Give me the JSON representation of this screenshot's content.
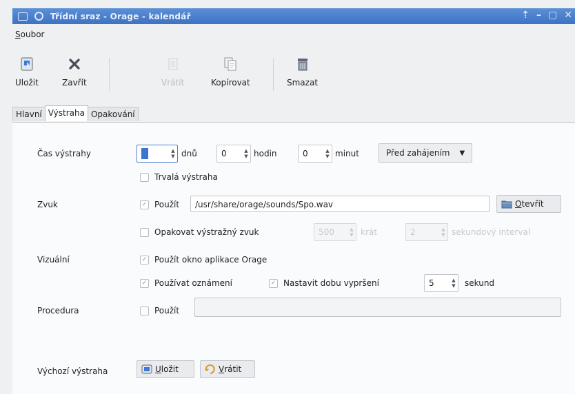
{
  "window": {
    "title": "Třídní sraz - Orage - kalendář"
  },
  "menu": {
    "file": "Soubor"
  },
  "toolbar": {
    "save": "Uložit",
    "close": "Zavřít",
    "revert": "Vrátit",
    "copy": "Kopírovat",
    "delete": "Smazat"
  },
  "tabs": [
    "Hlavní",
    "Výstraha",
    "Opakování"
  ],
  "alarm": {
    "time_label": "Čas výstrahy",
    "days_value": "",
    "days_unit": "dnů",
    "hours_value": "0",
    "hours_unit": "hodin",
    "minutes_value": "0",
    "minutes_unit": "minut",
    "relation": "Před zahájením",
    "persistent": "Trvalá výstraha"
  },
  "sound": {
    "label": "Zvuk",
    "use": "Použít",
    "file": "/usr/share/orage/sounds/Spo.wav",
    "open_button": "Otevřít",
    "repeat": "Opakovat výstražný zvuk",
    "repeat_count": "500",
    "repeat_unit": "krát",
    "interval_value": "2",
    "interval_unit": "sekundový interval"
  },
  "visual": {
    "label": "Vizuální",
    "use_window": "Použít okno aplikace Orage",
    "use_notify": "Používat oznámení",
    "set_timeout": "Nastavit dobu vypršení",
    "timeout_value": "5",
    "timeout_unit": "sekund"
  },
  "procedure": {
    "label": "Procedura",
    "use": "Použít",
    "command": ""
  },
  "default_alarm": {
    "label": "Výchozí výstraha",
    "save": "Uložit",
    "revert": "Vrátit"
  },
  "colors": {
    "titlebar": "#3d73c3",
    "accent": "#3b74d1"
  }
}
